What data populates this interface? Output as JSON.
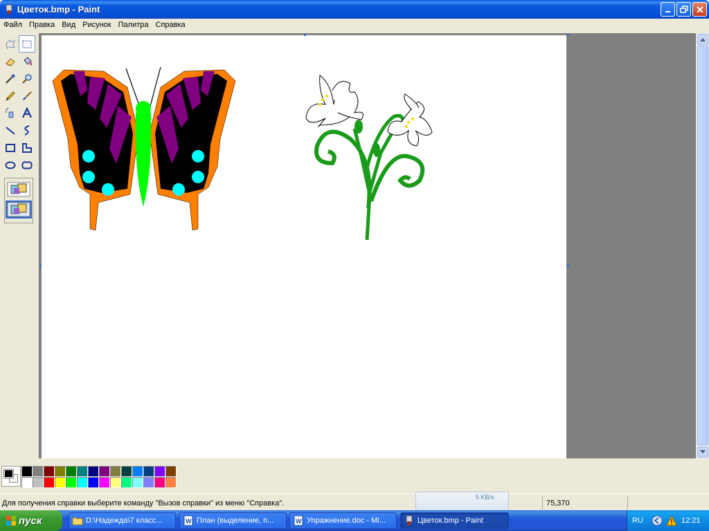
{
  "window": {
    "title": "Цветок.bmp - Paint"
  },
  "menu": {
    "items": [
      "Файл",
      "Правка",
      "Вид",
      "Рисунок",
      "Палитра",
      "Справка"
    ]
  },
  "tools": [
    "free-select-icon",
    "rect-select-icon",
    "eraser-icon",
    "fill-icon",
    "color-picker-icon",
    "magnifier-icon",
    "pencil-icon",
    "brush-icon",
    "airbrush-icon",
    "text-icon",
    "line-icon",
    "curve-icon",
    "rectangle-icon",
    "polygon-icon",
    "ellipse-icon",
    "rounded-rect-icon"
  ],
  "palette": {
    "foreground": "#000000",
    "background": "#ffffff",
    "colors": [
      "#000000",
      "#808080",
      "#800000",
      "#808000",
      "#008000",
      "#008080",
      "#000080",
      "#800080",
      "#808040",
      "#004040",
      "#0080ff",
      "#004080",
      "#8000ff",
      "#804000",
      "#ffffff",
      "#c0c0c0",
      "#ff0000",
      "#ffff00",
      "#00ff00",
      "#00ffff",
      "#0000ff",
      "#ff00ff",
      "#ffff80",
      "#00ff80",
      "#80ffff",
      "#8080ff",
      "#ff0080",
      "#ff8040"
    ]
  },
  "status": {
    "help_text": "Для получения справки выберите команду \"Вызов справки\" из меню \"Справка\".",
    "net_rate": "5 KB/s",
    "coords": "75,370"
  },
  "taskbar": {
    "start_label": "пуск",
    "tasks": [
      "D:\\Надежда\\7 класс...",
      "План (выделение, п...",
      "Упражнение.doc - Mi...",
      "Цветок.bmp - Paint"
    ],
    "lang": "RU",
    "clock": "12:21"
  }
}
